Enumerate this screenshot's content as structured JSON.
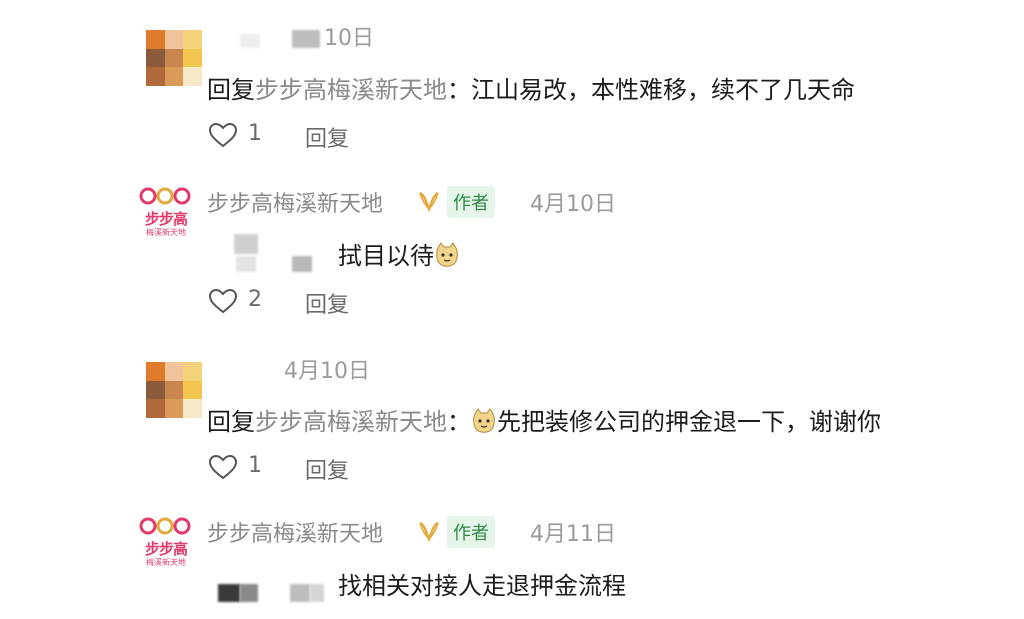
{
  "comments": [
    {
      "date": "10日",
      "reply_prefix": "回复",
      "reply_target": "步步高梅溪新天地",
      "colon": "：",
      "text": "江山易改，本性难移，续不了几天命",
      "likes": "1",
      "reply_label": "回复"
    },
    {
      "username": "步步高梅溪新天地",
      "badge": "作者",
      "date": "4月10日",
      "text": "拭目以待",
      "likes": "2",
      "reply_label": "回复"
    },
    {
      "date": "4月10日",
      "reply_prefix": "回复",
      "reply_target": "步步高梅溪新天地",
      "colon": "：",
      "text": "先把装修公司的押金退一下，谢谢你",
      "likes": "1",
      "reply_label": "回复"
    },
    {
      "username": "步步高梅溪新天地",
      "badge": "作者",
      "date": "4月11日",
      "text": "找相关对接人走退押金流程"
    }
  ],
  "brand_logo": {
    "main": "步步高",
    "sub": "梅溪新天地"
  },
  "colors": {
    "badge_green": "#2d8a45",
    "badge_bg": "#e6f5ea",
    "logo_pink": "#e23a6a",
    "logo_gold": "#e5a93b"
  },
  "icons": [
    "heart-icon",
    "verified-badge-icon",
    "cat-emoji-icon"
  ]
}
